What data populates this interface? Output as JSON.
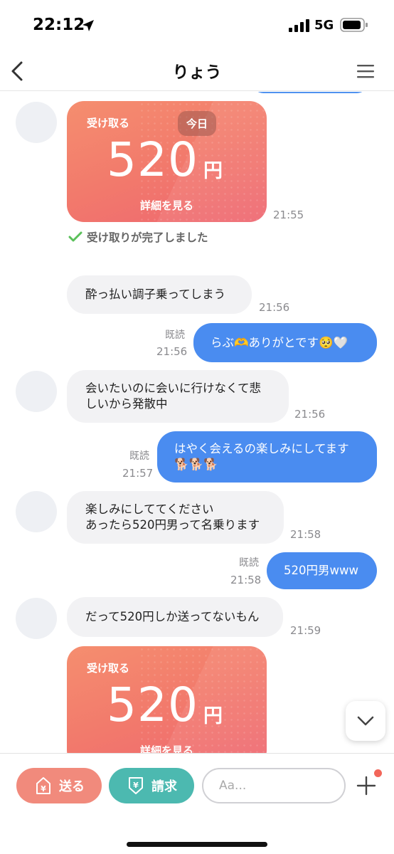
{
  "status_bar": {
    "time": "22:12",
    "network": "5G"
  },
  "header": {
    "title": "りょう"
  },
  "messages": {
    "card1": {
      "label": "受け取る",
      "amount": "520",
      "unit": "円",
      "detail": "詳細を見る",
      "date_badge": "今日",
      "time": "21:55"
    },
    "received_notice": "受け取りが完了しました",
    "m1": {
      "text": "酔っ払い調子乗ってしまう",
      "time": "21:56"
    },
    "m2": {
      "text": "らぶ🫶ありがとです🥺🤍",
      "read": "既読",
      "time": "21:56"
    },
    "m3": {
      "line1": "会いたいのに会いに行けなくて悲",
      "line2": "しいから発散中",
      "time": "21:56"
    },
    "m4": {
      "line1": "はやく会えるの楽しみにしてます",
      "line2": "🐕🐕🐕",
      "read": "既読",
      "time": "21:57"
    },
    "m5": {
      "line1": "楽しみにしててください",
      "line2": "あったら520円男って名乗ります",
      "time": "21:58"
    },
    "m6": {
      "text": "520円男www",
      "read": "既読",
      "time": "21:58"
    },
    "m7": {
      "text": "だって520円しか送ってないもん",
      "time": "21:59"
    },
    "card2": {
      "label": "受け取る",
      "amount": "520",
      "unit": "円",
      "detail": "詳細を見る"
    }
  },
  "bottom_bar": {
    "send_label": "送る",
    "request_label": "請求",
    "input_placeholder": "Aa..."
  },
  "colors": {
    "outgoing_bubble": "#4a8cf0",
    "incoming_bubble": "#f2f2f4",
    "send_button": "#f18a7c",
    "request_button": "#4cb9b0",
    "card_gradient": [
      "#f58e6f",
      "#ee6670"
    ]
  },
  "icons": [
    "location-arrow-icon",
    "signal-icon",
    "battery-icon",
    "back-chevron-icon",
    "hamburger-menu-icon",
    "checkmark-icon",
    "chevron-down-icon",
    "yen-send-icon",
    "yen-request-icon",
    "plus-icon"
  ]
}
